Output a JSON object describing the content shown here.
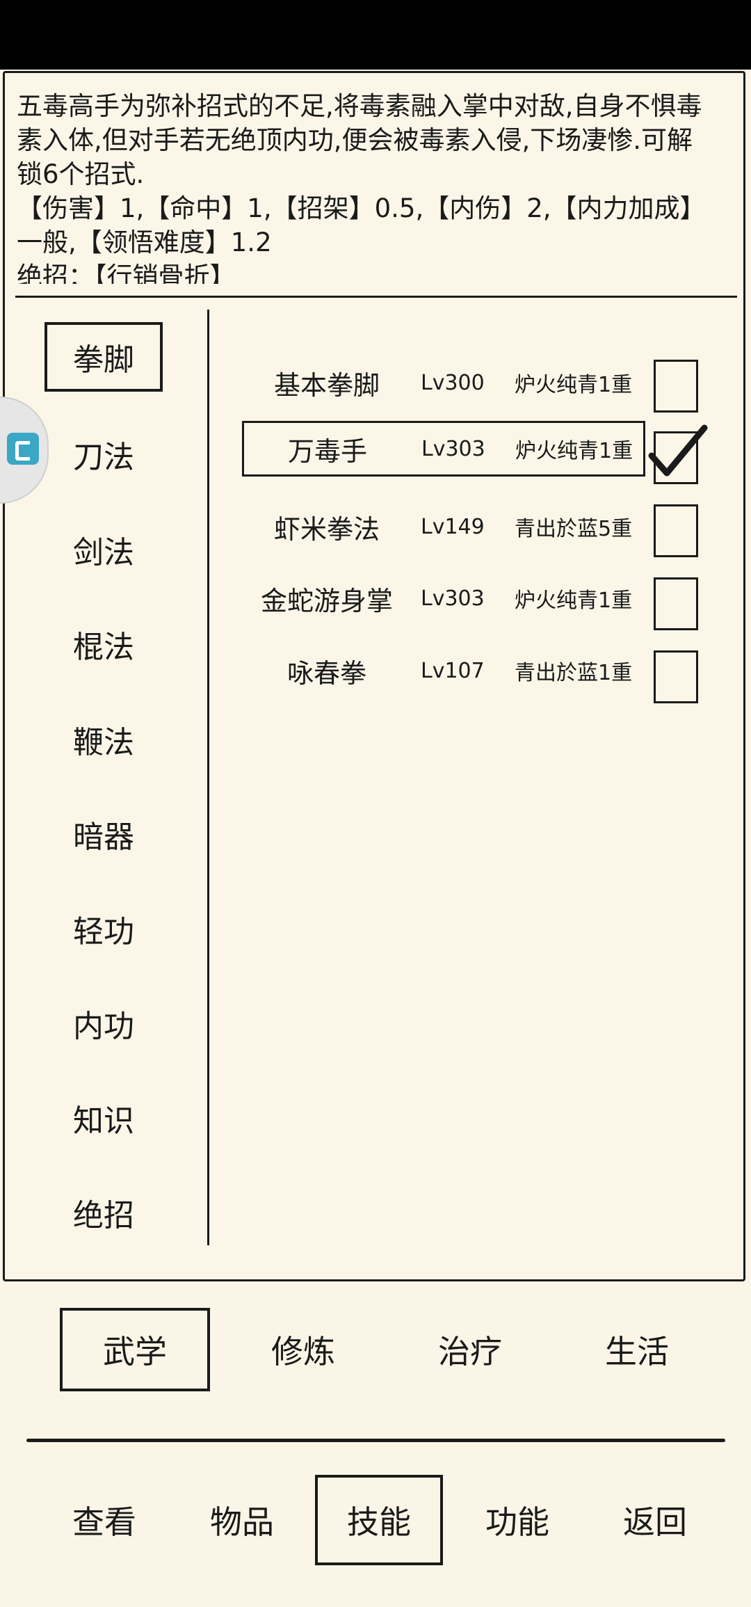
{
  "description": {
    "line1": "五毒高手为弥补招式的不足,将毒素融入掌中对敌,自身不惧毒",
    "line2": "素入体,但对手若无绝顶内功,便会被毒素入侵,下场凄惨.可解",
    "line3": "锁6个招式.",
    "line4": "【伤害】1,【命中】1,【招架】0.5,【内伤】2,【内力加成】",
    "line5": "一般,【领悟难度】1.2",
    "line6": "绝招：【行销骨折】"
  },
  "categories": [
    {
      "label": "拳脚",
      "selected": true
    },
    {
      "label": "刀法",
      "selected": false
    },
    {
      "label": "剑法",
      "selected": false
    },
    {
      "label": "棍法",
      "selected": false
    },
    {
      "label": "鞭法",
      "selected": false
    },
    {
      "label": "暗器",
      "selected": false
    },
    {
      "label": "轻功",
      "selected": false
    },
    {
      "label": "内功",
      "selected": false
    },
    {
      "label": "知识",
      "selected": false
    },
    {
      "label": "绝招",
      "selected": false
    }
  ],
  "skills": [
    {
      "name": "基本拳脚",
      "level": "Lv300",
      "realm": "炉火纯青1重",
      "checked": false,
      "selected": false
    },
    {
      "name": "万毒手",
      "level": "Lv303",
      "realm": "炉火纯青1重",
      "checked": true,
      "selected": true
    },
    {
      "name": "虾米拳法",
      "level": "Lv149",
      "realm": "青出於蓝5重",
      "checked": false,
      "selected": false
    },
    {
      "name": "金蛇游身掌",
      "level": "Lv303",
      "realm": "炉火纯青1重",
      "checked": false,
      "selected": false
    },
    {
      "name": "咏春拳",
      "level": "Lv107",
      "realm": "青出於蓝1重",
      "checked": false,
      "selected": false
    }
  ],
  "sub_tabs": [
    {
      "label": "武学",
      "selected": true
    },
    {
      "label": "修炼",
      "selected": false
    },
    {
      "label": "治疗",
      "selected": false
    },
    {
      "label": "生活",
      "selected": false
    }
  ],
  "nav_tabs": [
    {
      "label": "查看",
      "selected": false
    },
    {
      "label": "物品",
      "selected": false
    },
    {
      "label": "技能",
      "selected": true
    },
    {
      "label": "功能",
      "selected": false
    },
    {
      "label": "返回",
      "selected": false
    }
  ],
  "floating_widget_icon": "app-shortcut-icon"
}
